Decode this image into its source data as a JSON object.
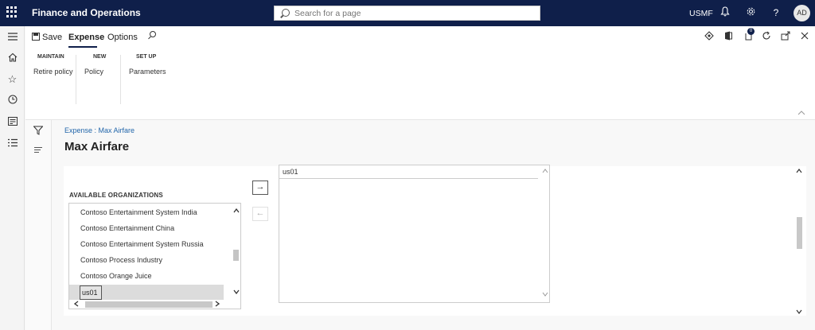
{
  "topbar": {
    "app_title": "Finance and Operations",
    "search_placeholder": "Search for a page",
    "company": "USMF",
    "avatar_initials": "AD",
    "icons": [
      "waffle-icon",
      "bell-icon",
      "gear-icon",
      "help-icon"
    ]
  },
  "leftnav": {
    "icons": [
      "hamburger-icon",
      "home-icon",
      "star-icon",
      "clock-icon",
      "workspace-icon",
      "list-icon"
    ]
  },
  "actionpane": {
    "save_label": "Save",
    "tabs": [
      {
        "label": "Expense",
        "selected": true
      },
      {
        "label": "Options",
        "selected": false
      }
    ],
    "groups": [
      {
        "title": "MAINTAIN",
        "buttons": [
          "Retire policy"
        ]
      },
      {
        "title": "NEW",
        "buttons": [
          "Policy"
        ]
      },
      {
        "title": "SET UP",
        "buttons": [
          "Parameters"
        ]
      }
    ],
    "right_icons": [
      "diamond-icon",
      "office-icon",
      "attachment-icon",
      "refresh-icon",
      "popout-icon",
      "close-icon"
    ],
    "attachment_count": "0"
  },
  "content": {
    "breadcrumb": "Expense : Max Airfare",
    "page_title": "Max Airfare",
    "available_header": "AVAILABLE ORGANIZATIONS",
    "available_items": [
      "Contoso Entertainment System India",
      "Contoso Entertainment China",
      "Contoso Entertainment System Russia",
      "Contoso Process Industry",
      "Contoso Orange Juice",
      "us01"
    ],
    "selected_available": "us01",
    "selected_items": [
      "us01"
    ],
    "move_right_glyph": "→",
    "move_left_glyph": "←"
  }
}
